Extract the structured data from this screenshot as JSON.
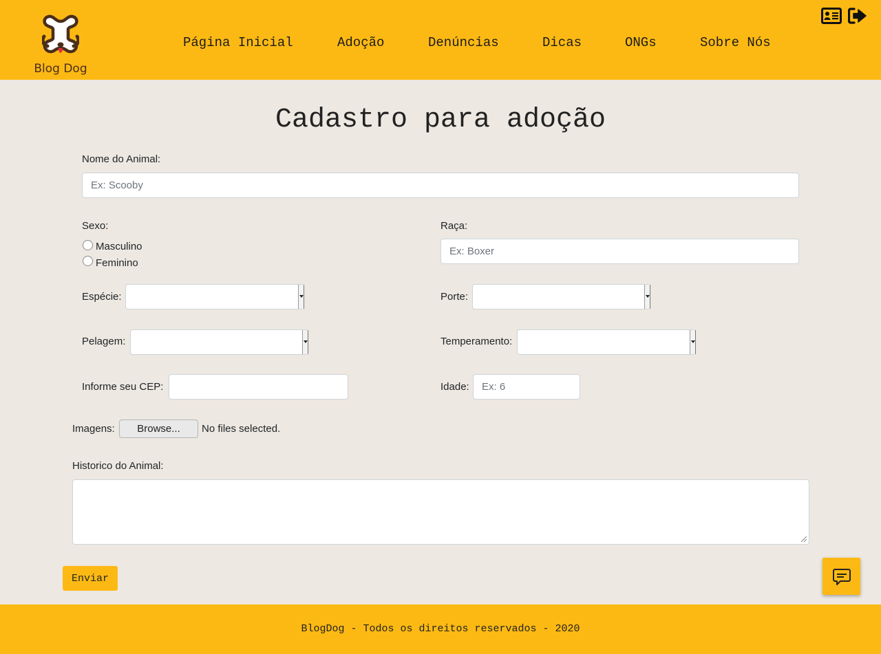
{
  "header": {
    "logo_text": "Blog Dog",
    "nav": [
      "Página Inicial",
      "Adoção",
      "Denúncias",
      "Dicas",
      "ONGs",
      "Sobre Nós"
    ],
    "icons": [
      "id-card-icon",
      "sign-out-icon"
    ]
  },
  "form": {
    "title": "Cadastro para adoção",
    "nome": {
      "label": "Nome do Animal:",
      "placeholder": "Ex: Scooby"
    },
    "sexo": {
      "label": "Sexo:",
      "options": [
        "Masculino",
        "Feminino"
      ]
    },
    "raca": {
      "label": "Raça:",
      "placeholder": "Ex: Boxer"
    },
    "especie": {
      "label": "Espécie:"
    },
    "porte": {
      "label": "Porte:"
    },
    "pelagem": {
      "label": "Pelagem:"
    },
    "temperamento": {
      "label": "Temperamento:"
    },
    "cep": {
      "label": "Informe seu CEP:"
    },
    "idade": {
      "label": "Idade:",
      "placeholder": "Ex: 6"
    },
    "imagens": {
      "label": "Imagens:",
      "button": "Browse...",
      "status": "No files selected."
    },
    "historico": {
      "label": "Historico do Animal:"
    },
    "submit": "Enviar"
  },
  "footer": {
    "text": "BlogDog - Todos os direitos reservados - 2020"
  },
  "colors": {
    "accent": "#fdb913",
    "background": "#ede8e1",
    "logo_brown": "#4a2e1b",
    "logo_tongue": "#e0303a"
  }
}
